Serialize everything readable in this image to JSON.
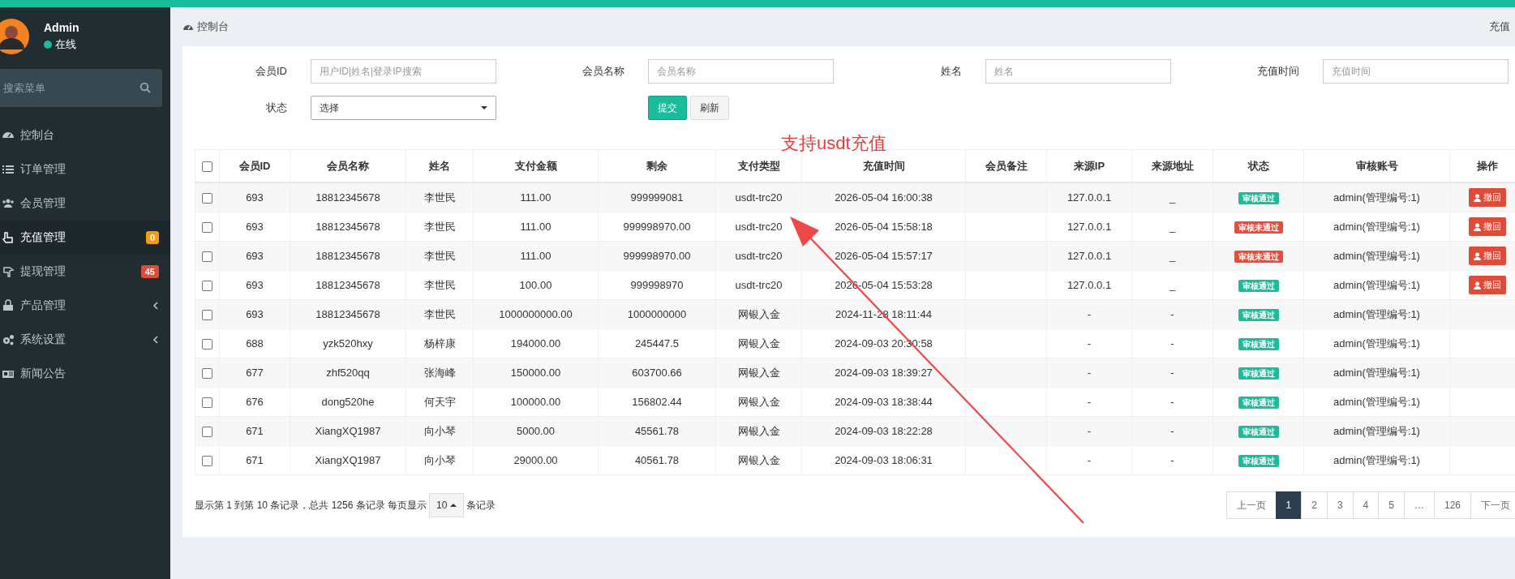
{
  "sidebar": {
    "user": {
      "name": "Admin",
      "status": "在线",
      "online": true
    },
    "search": {
      "placeholder": "搜索菜单"
    },
    "items": [
      {
        "label": "控制台",
        "selected": false,
        "submenu": false
      },
      {
        "label": "订单管理",
        "selected": false,
        "submenu": false
      },
      {
        "label": "会员管理",
        "selected": false,
        "submenu": false
      },
      {
        "label": "充值管理",
        "selected": true,
        "submenu": false,
        "badge": "0",
        "color": "#f39c12"
      },
      {
        "label": "提现管理",
        "selected": false,
        "submenu": false,
        "badge": "45",
        "color": "#dd4b39"
      },
      {
        "label": "产品管理",
        "selected": false,
        "submenu": true
      },
      {
        "label": "系统设置",
        "selected": false,
        "submenu": true
      },
      {
        "label": "新闻公告",
        "selected": false,
        "submenu": false
      }
    ]
  },
  "breadcrumb": {
    "title": "控制台",
    "right": "充值"
  },
  "filters": {
    "fields": [
      {
        "label": "会员ID",
        "placeholder": "用户ID|姓名|登录IP搜索"
      },
      {
        "label": "会员名称",
        "placeholder": "会员名称"
      },
      {
        "label": "姓名",
        "placeholder": "姓名"
      },
      {
        "label": "充值时间",
        "placeholder": "充值时间"
      }
    ],
    "status": {
      "label": "状态",
      "value": "选择"
    },
    "buttons": [
      {
        "label": "提交",
        "kind": "primary"
      },
      {
        "label": "刷新",
        "kind": "default"
      }
    ]
  },
  "table": {
    "select_all": {
      "checked": false
    },
    "columns": [
      "会员ID",
      "会员名称",
      "姓名",
      "支付金额",
      "剩余",
      "支付类型",
      "充值时间",
      "会员备注",
      "来源IP",
      "来源地址",
      "状态",
      "审核账号",
      "操作"
    ],
    "rows": [
      {
        "checked": false,
        "id": "693",
        "member": "18812345678",
        "name": "李世民",
        "amount": "111.00",
        "remaining": "999999081",
        "pay_type": "usdt-trc20",
        "time": "2026-05-04 16:00:38",
        "ip": "127.0.0.1",
        "address": "_",
        "status": "审核通过",
        "color": "#1abc9c",
        "reviewer": "admin(管理编号:1)",
        "action": "撤回"
      },
      {
        "checked": false,
        "id": "693",
        "member": "18812345678",
        "name": "李世民",
        "amount": "111.00",
        "remaining": "999998970.00",
        "pay_type": "usdt-trc20",
        "time": "2026-05-04 15:58:18",
        "ip": "127.0.0.1",
        "address": "_",
        "status": "审核未通过",
        "color": "#e74c3c",
        "reviewer": "admin(管理编号:1)",
        "action": "撤回"
      },
      {
        "checked": false,
        "id": "693",
        "member": "18812345678",
        "name": "李世民",
        "amount": "111.00",
        "remaining": "999998970.00",
        "pay_type": "usdt-trc20",
        "time": "2026-05-04 15:57:17",
        "ip": "127.0.0.1",
        "address": "_",
        "status": "审核未通过",
        "color": "#e74c3c",
        "reviewer": "admin(管理编号:1)",
        "action": "撤回"
      },
      {
        "checked": false,
        "id": "693",
        "member": "18812345678",
        "name": "李世民",
        "amount": "100.00",
        "remaining": "999998970",
        "pay_type": "usdt-trc20",
        "time": "2026-05-04 15:53:28",
        "ip": "127.0.0.1",
        "address": "_",
        "status": "审核通过",
        "color": "#1abc9c",
        "reviewer": "admin(管理编号:1)",
        "action": "撤回"
      },
      {
        "checked": false,
        "id": "693",
        "member": "18812345678",
        "name": "李世民",
        "amount": "1000000000.00",
        "remaining": "1000000000",
        "pay_type": "网银入金",
        "time": "2024-11-28 18:11:44",
        "ip": "-",
        "address": "-",
        "status": "审核通过",
        "color": "#1abc9c",
        "reviewer": "admin(管理编号:1)"
      },
      {
        "checked": false,
        "id": "688",
        "member": "yzk520hxy",
        "name": "杨梓康",
        "amount": "194000.00",
        "remaining": "245447.5",
        "pay_type": "网银入金",
        "time": "2024-09-03 20:30:58",
        "ip": "-",
        "address": "-",
        "status": "审核通过",
        "color": "#1abc9c",
        "reviewer": "admin(管理编号:1)"
      },
      {
        "checked": false,
        "id": "677",
        "member": "zhf520qq",
        "name": "张海峰",
        "amount": "150000.00",
        "remaining": "603700.66",
        "pay_type": "网银入金",
        "time": "2024-09-03 18:39:27",
        "ip": "-",
        "address": "-",
        "status": "审核通过",
        "color": "#1abc9c",
        "reviewer": "admin(管理编号:1)"
      },
      {
        "checked": false,
        "id": "676",
        "member": "dong520he",
        "name": "何天宇",
        "amount": "100000.00",
        "remaining": "156802.44",
        "pay_type": "网银入金",
        "time": "2024-09-03 18:38:44",
        "ip": "-",
        "address": "-",
        "status": "审核通过",
        "color": "#1abc9c",
        "reviewer": "admin(管理编号:1)"
      },
      {
        "checked": false,
        "id": "671",
        "member": "XiangXQ1987",
        "name": "向小琴",
        "amount": "5000.00",
        "remaining": "45561.78",
        "pay_type": "网银入金",
        "time": "2024-09-03 18:22:28",
        "ip": "-",
        "address": "-",
        "status": "审核通过",
        "color": "#1abc9c",
        "reviewer": "admin(管理编号:1)"
      },
      {
        "checked": false,
        "id": "671",
        "member": "XiangXQ1987",
        "name": "向小琴",
        "amount": "29000.00",
        "remaining": "40561.78",
        "pay_type": "网银入金",
        "time": "2024-09-03 18:06:31",
        "ip": "-",
        "address": "-",
        "status": "审核通过",
        "color": "#1abc9c",
        "reviewer": "admin(管理编号:1)"
      }
    ]
  },
  "pager": {
    "summary": "显示第 1 到第 10 条记录，总共 1256 条记录 每页显示",
    "page_size": "10",
    "suffix": "条记录",
    "pages": [
      {
        "label": "上一页",
        "selected": false
      },
      {
        "label": "1",
        "selected": true
      },
      {
        "label": "2",
        "selected": false
      },
      {
        "label": "3",
        "selected": false
      },
      {
        "label": "4",
        "selected": false
      },
      {
        "label": "5",
        "selected": false
      },
      {
        "label": "…",
        "selected": false
      },
      {
        "label": "126",
        "selected": false
      },
      {
        "label": "下一页",
        "selected": false
      }
    ]
  },
  "annotation": {
    "text": "支持usdt充值"
  }
}
